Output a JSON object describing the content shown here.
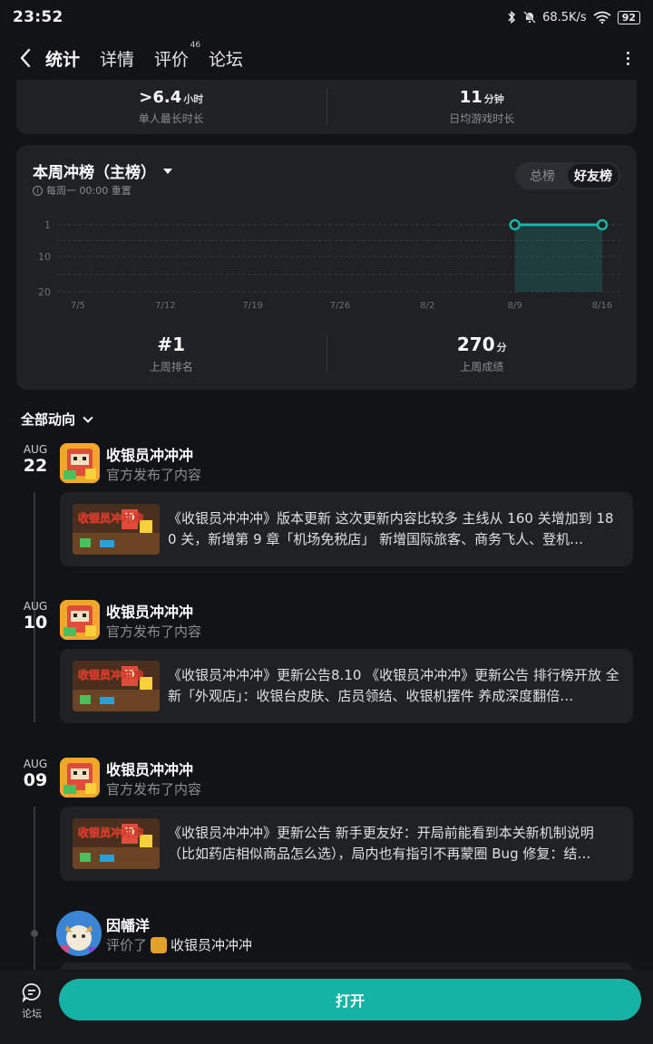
{
  "status_bar": {
    "time": "23:52",
    "net_speed": "68.5K/s",
    "battery": "92"
  },
  "nav": {
    "tabs": [
      {
        "label": "统计",
        "active": true
      },
      {
        "label": "详情",
        "active": false
      },
      {
        "label": "评价",
        "active": false,
        "badge": "46"
      },
      {
        "label": "论坛",
        "active": false
      }
    ]
  },
  "stats": {
    "max_time": {
      "prefix": ">",
      "value": "6.4",
      "unit": "小时",
      "label": "单人最长时长"
    },
    "daily_time": {
      "value": "11",
      "unit": "分钟",
      "label": "日均游戏时长"
    }
  },
  "ranking": {
    "title": "本周冲榜（主榜）",
    "subtitle": "每周一 00:00 重置",
    "seg_total": "总榜",
    "seg_friends": "好友榜",
    "last_week_rank": "#1",
    "last_week_rank_label": "上周排名",
    "last_week_score": "270",
    "last_week_score_unit": "分",
    "last_week_score_label": "上周成绩"
  },
  "chart_data": {
    "type": "line",
    "x": [
      "7/5",
      "7/12",
      "7/19",
      "7/26",
      "8/2",
      "8/9",
      "8/16"
    ],
    "y_ticks": [
      "1",
      "10",
      "20"
    ],
    "y_reversed": true,
    "ylim": [
      1,
      20
    ],
    "series": [
      {
        "values": [
          null,
          null,
          null,
          null,
          null,
          1,
          1
        ]
      }
    ],
    "accent": "#19b5a8"
  },
  "feed": {
    "filter_label": "全部动向",
    "items": [
      {
        "month": "AUG",
        "day": "22",
        "author": "收银员冲冲冲",
        "action": "官方发布了内容",
        "text": "《收银员冲冲冲》版本更新 这次更新内容比较多 主线从 160 关增加到 180 关，新增第 9 章「机场免税店」 新增国际旅客、商务飞人、登机…"
      },
      {
        "month": "AUG",
        "day": "10",
        "author": "收银员冲冲冲",
        "action": "官方发布了内容",
        "text": "《收银员冲冲冲》更新公告8.10 《收银员冲冲冲》更新公告 排行榜开放 全新「外观店」：收银台皮肤、店员领结、收银机摆件 养成深度翻倍…"
      },
      {
        "month": "AUG",
        "day": "09",
        "author": "收银员冲冲冲",
        "action": "官方发布了内容",
        "text": "《收银员冲冲冲》更新公告 新手更友好：开局前能看到本关新机制说明（比如药店相似商品怎么选），局内也有指引不再蒙圈 Bug 修复：结…"
      },
      {
        "author": "因幡洋",
        "action": "评价了",
        "target": "收银员冲冲冲"
      }
    ],
    "thumb_text": "收银员冲冲冲"
  },
  "bottom": {
    "forum_label": "论坛",
    "open_label": "打开"
  }
}
